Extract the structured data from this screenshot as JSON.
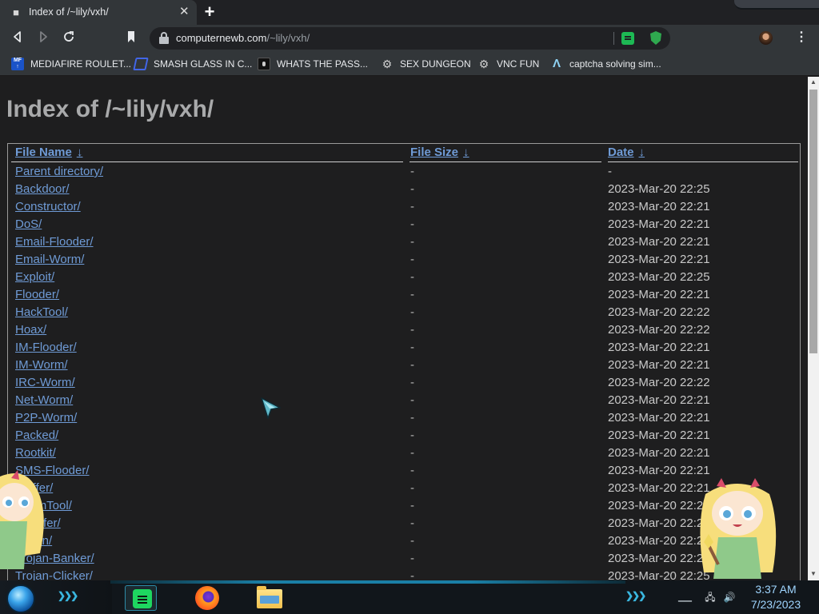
{
  "browser": {
    "tab": {
      "title": "Index of /~lily/vxh/",
      "favicon": "server-icon"
    },
    "new_tab_label": "+",
    "url": {
      "domain": "computernewb.com",
      "path": "/~lily/vxh/"
    },
    "bookmarks": [
      {
        "label": "MEDIAFIRE ROULET...",
        "icon": "mediafire-icon"
      },
      {
        "label": "SMASH GLASS IN C...",
        "icon": "glass-icon"
      },
      {
        "label": "WHATS THE PASS...",
        "icon": "lock-icon"
      },
      {
        "label": "SEX DUNGEON",
        "icon": "gear-icon"
      },
      {
        "label": "VNC FUN",
        "icon": "gear-icon"
      },
      {
        "label": "captcha solving sim...",
        "icon": "caret-icon"
      }
    ]
  },
  "page": {
    "title": "Index of /~lily/vxh/",
    "columns": {
      "name": "File Name",
      "size": "File Size",
      "date": "Date",
      "sort_glyph": "↓"
    },
    "rows": [
      {
        "name": "Parent directory/",
        "size": "-",
        "date": "-"
      },
      {
        "name": "Backdoor/",
        "size": "-",
        "date": "2023-Mar-20 22:25"
      },
      {
        "name": "Constructor/",
        "size": "-",
        "date": "2023-Mar-20 22:21"
      },
      {
        "name": "DoS/",
        "size": "-",
        "date": "2023-Mar-20 22:21"
      },
      {
        "name": "Email-Flooder/",
        "size": "-",
        "date": "2023-Mar-20 22:21"
      },
      {
        "name": "Email-Worm/",
        "size": "-",
        "date": "2023-Mar-20 22:21"
      },
      {
        "name": "Exploit/",
        "size": "-",
        "date": "2023-Mar-20 22:25"
      },
      {
        "name": "Flooder/",
        "size": "-",
        "date": "2023-Mar-20 22:21"
      },
      {
        "name": "HackTool/",
        "size": "-",
        "date": "2023-Mar-20 22:22"
      },
      {
        "name": "Hoax/",
        "size": "-",
        "date": "2023-Mar-20 22:22"
      },
      {
        "name": "IM-Flooder/",
        "size": "-",
        "date": "2023-Mar-20 22:21"
      },
      {
        "name": "IM-Worm/",
        "size": "-",
        "date": "2023-Mar-20 22:21"
      },
      {
        "name": "IRC-Worm/",
        "size": "-",
        "date": "2023-Mar-20 22:22"
      },
      {
        "name": "Net-Worm/",
        "size": "-",
        "date": "2023-Mar-20 22:21"
      },
      {
        "name": "P2P-Worm/",
        "size": "-",
        "date": "2023-Mar-20 22:21"
      },
      {
        "name": "Packed/",
        "size": "-",
        "date": "2023-Mar-20 22:21"
      },
      {
        "name": "Rootkit/",
        "size": "-",
        "date": "2023-Mar-20 22:21"
      },
      {
        "name": "SMS-Flooder/",
        "size": "-",
        "date": "2023-Mar-20 22:21"
      },
      {
        "name": "Sniffer/",
        "size": "-",
        "date": "2023-Mar-20 22:21"
      },
      {
        "name": "SpamTool/",
        "size": "-",
        "date": "2023-Mar-20 22:21"
      },
      {
        "name": "Spoofer/",
        "size": "-",
        "date": "2023-Mar-20 22:21"
      },
      {
        "name": "Trojan/",
        "size": "-",
        "date": "2023-Mar-20 22:21"
      },
      {
        "name": "Trojan-Banker/",
        "size": "-",
        "date": "2023-Mar-20 22:21"
      },
      {
        "name": "Trojan-Clicker/",
        "size": "-",
        "date": "2023-Mar-20 22:25"
      }
    ]
  },
  "taskbar": {
    "apps": [
      "spotify-icon",
      "firefox-icon",
      "file-explorer-icon"
    ],
    "time": "3:37 AM",
    "date": "7/23/2023"
  },
  "colors": {
    "link": "#6f9bd6",
    "page_bg": "#1e1e1f",
    "title": "#a9aaab",
    "clock": "#9fd5ff"
  }
}
